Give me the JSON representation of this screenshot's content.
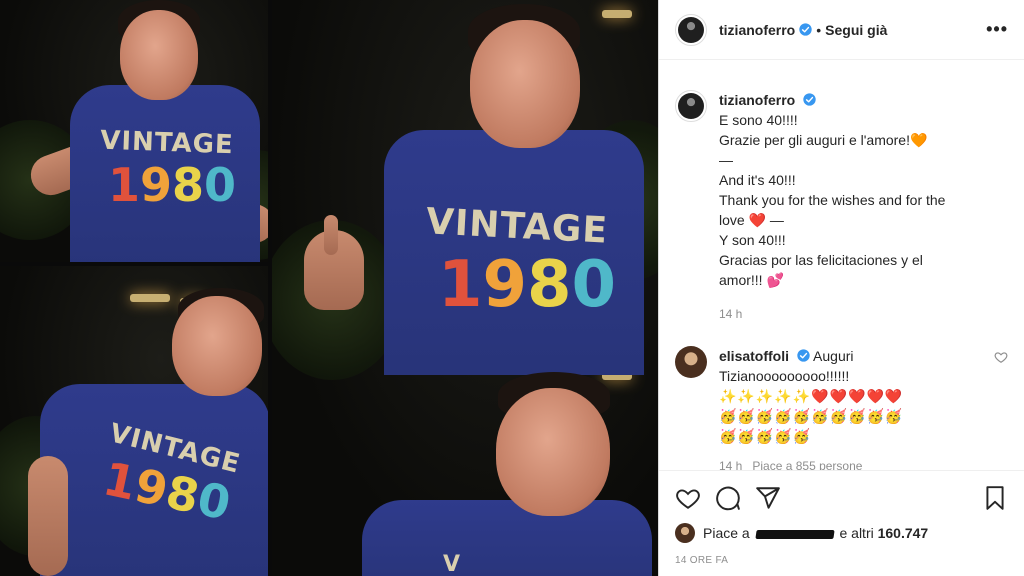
{
  "post": {
    "author": "tizianoferro",
    "follow_status": "Segui già",
    "more_label": "•••",
    "caption": [
      "E sono 40!!!!",
      "Grazie per gli auguri e l'amore!🧡",
      "—",
      "And it's 40!!!",
      "Thank you for the wishes and for the",
      "love ❤️ —",
      "Y son 40!!!",
      "Gracias por las felicitaciones y el",
      "amor!!! 💕"
    ],
    "caption_time": "14 h"
  },
  "comment": {
    "author": "elisatoffoli",
    "text_first": "Auguri",
    "text_second": "Tizianooooooooo!!!!!!",
    "emoji_row1": "✨✨✨✨✨❤️❤️❤️❤️❤️",
    "emoji_row2": "🥳🥳🥳🥳🥳🥳🥳🥳🥳🥳",
    "emoji_row3": "🥳🥳🥳🥳🥳",
    "meta": "14 h   Piace a 855 persone"
  },
  "likes": {
    "prefix": "Piace a",
    "suffix": "e altri",
    "count": "160.747"
  },
  "timestamp": "14 ORE FA",
  "photo_text": {
    "vintage": "VINTAGE",
    "year_digits": [
      "1",
      "9",
      "8",
      "0"
    ]
  },
  "colors": {
    "verified": "#3897f0",
    "shirt": "#2f3b8c"
  }
}
